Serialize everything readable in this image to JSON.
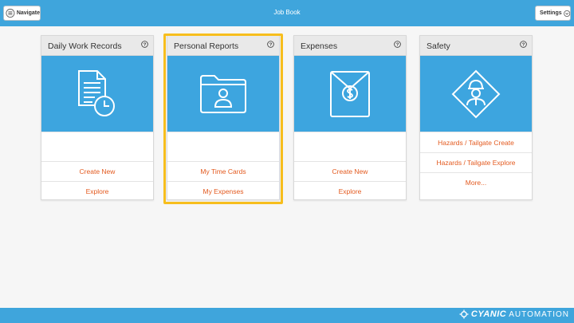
{
  "topbar": {
    "navigate_label": "Navigate",
    "title": "Job Book",
    "settings_label": "Settings",
    "color": "#3fa5dc"
  },
  "cards": [
    {
      "title": "Daily Work Records",
      "icon": "document-clock-icon",
      "links": [
        "",
        "Create New",
        "Explore"
      ]
    },
    {
      "title": "Personal Reports",
      "icon": "folder-person-icon",
      "links": [
        "",
        "My Time Cards",
        "My Expenses"
      ],
      "highlighted": true
    },
    {
      "title": "Expenses",
      "icon": "envelope-dollar-icon",
      "links": [
        "",
        "Create New",
        "Explore"
      ]
    },
    {
      "title": "Safety",
      "icon": "worker-sign-icon",
      "links": [
        "Hazards / Tailgate Create",
        "Hazards / Tailgate Explore",
        "More..."
      ]
    }
  ],
  "footer": {
    "brand_name": "CYANIC",
    "brand_suffix": "AUTOMATION"
  },
  "colors": {
    "accent": "#3da5df",
    "link": "#e35a1f",
    "highlight": "#f7be1d"
  }
}
